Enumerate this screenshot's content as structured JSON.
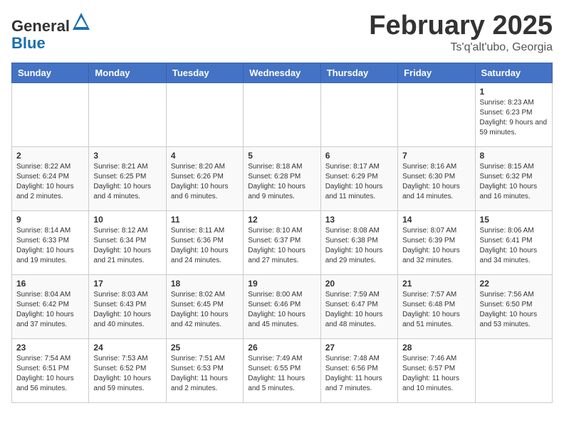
{
  "header": {
    "logo": {
      "general": "General",
      "blue": "Blue"
    },
    "title": "February 2025",
    "subtitle": "Ts'q'alt'ubo, Georgia"
  },
  "weekdays": [
    "Sunday",
    "Monday",
    "Tuesday",
    "Wednesday",
    "Thursday",
    "Friday",
    "Saturday"
  ],
  "weeks": [
    [
      null,
      null,
      null,
      null,
      null,
      null,
      {
        "day": "1",
        "sunrise": "8:23 AM",
        "sunset": "6:23 PM",
        "daylight": "9 hours and 59 minutes."
      }
    ],
    [
      {
        "day": "2",
        "sunrise": "8:22 AM",
        "sunset": "6:24 PM",
        "daylight": "10 hours and 2 minutes."
      },
      {
        "day": "3",
        "sunrise": "8:21 AM",
        "sunset": "6:25 PM",
        "daylight": "10 hours and 4 minutes."
      },
      {
        "day": "4",
        "sunrise": "8:20 AM",
        "sunset": "6:26 PM",
        "daylight": "10 hours and 6 minutes."
      },
      {
        "day": "5",
        "sunrise": "8:18 AM",
        "sunset": "6:28 PM",
        "daylight": "10 hours and 9 minutes."
      },
      {
        "day": "6",
        "sunrise": "8:17 AM",
        "sunset": "6:29 PM",
        "daylight": "10 hours and 11 minutes."
      },
      {
        "day": "7",
        "sunrise": "8:16 AM",
        "sunset": "6:30 PM",
        "daylight": "10 hours and 14 minutes."
      },
      {
        "day": "8",
        "sunrise": "8:15 AM",
        "sunset": "6:32 PM",
        "daylight": "10 hours and 16 minutes."
      }
    ],
    [
      {
        "day": "9",
        "sunrise": "8:14 AM",
        "sunset": "6:33 PM",
        "daylight": "10 hours and 19 minutes."
      },
      {
        "day": "10",
        "sunrise": "8:12 AM",
        "sunset": "6:34 PM",
        "daylight": "10 hours and 21 minutes."
      },
      {
        "day": "11",
        "sunrise": "8:11 AM",
        "sunset": "6:36 PM",
        "daylight": "10 hours and 24 minutes."
      },
      {
        "day": "12",
        "sunrise": "8:10 AM",
        "sunset": "6:37 PM",
        "daylight": "10 hours and 27 minutes."
      },
      {
        "day": "13",
        "sunrise": "8:08 AM",
        "sunset": "6:38 PM",
        "daylight": "10 hours and 29 minutes."
      },
      {
        "day": "14",
        "sunrise": "8:07 AM",
        "sunset": "6:39 PM",
        "daylight": "10 hours and 32 minutes."
      },
      {
        "day": "15",
        "sunrise": "8:06 AM",
        "sunset": "6:41 PM",
        "daylight": "10 hours and 34 minutes."
      }
    ],
    [
      {
        "day": "16",
        "sunrise": "8:04 AM",
        "sunset": "6:42 PM",
        "daylight": "10 hours and 37 minutes."
      },
      {
        "day": "17",
        "sunrise": "8:03 AM",
        "sunset": "6:43 PM",
        "daylight": "10 hours and 40 minutes."
      },
      {
        "day": "18",
        "sunrise": "8:02 AM",
        "sunset": "6:45 PM",
        "daylight": "10 hours and 42 minutes."
      },
      {
        "day": "19",
        "sunrise": "8:00 AM",
        "sunset": "6:46 PM",
        "daylight": "10 hours and 45 minutes."
      },
      {
        "day": "20",
        "sunrise": "7:59 AM",
        "sunset": "6:47 PM",
        "daylight": "10 hours and 48 minutes."
      },
      {
        "day": "21",
        "sunrise": "7:57 AM",
        "sunset": "6:48 PM",
        "daylight": "10 hours and 51 minutes."
      },
      {
        "day": "22",
        "sunrise": "7:56 AM",
        "sunset": "6:50 PM",
        "daylight": "10 hours and 53 minutes."
      }
    ],
    [
      {
        "day": "23",
        "sunrise": "7:54 AM",
        "sunset": "6:51 PM",
        "daylight": "10 hours and 56 minutes."
      },
      {
        "day": "24",
        "sunrise": "7:53 AM",
        "sunset": "6:52 PM",
        "daylight": "10 hours and 59 minutes."
      },
      {
        "day": "25",
        "sunrise": "7:51 AM",
        "sunset": "6:53 PM",
        "daylight": "11 hours and 2 minutes."
      },
      {
        "day": "26",
        "sunrise": "7:49 AM",
        "sunset": "6:55 PM",
        "daylight": "11 hours and 5 minutes."
      },
      {
        "day": "27",
        "sunrise": "7:48 AM",
        "sunset": "6:56 PM",
        "daylight": "11 hours and 7 minutes."
      },
      {
        "day": "28",
        "sunrise": "7:46 AM",
        "sunset": "6:57 PM",
        "daylight": "11 hours and 10 minutes."
      },
      null
    ]
  ]
}
